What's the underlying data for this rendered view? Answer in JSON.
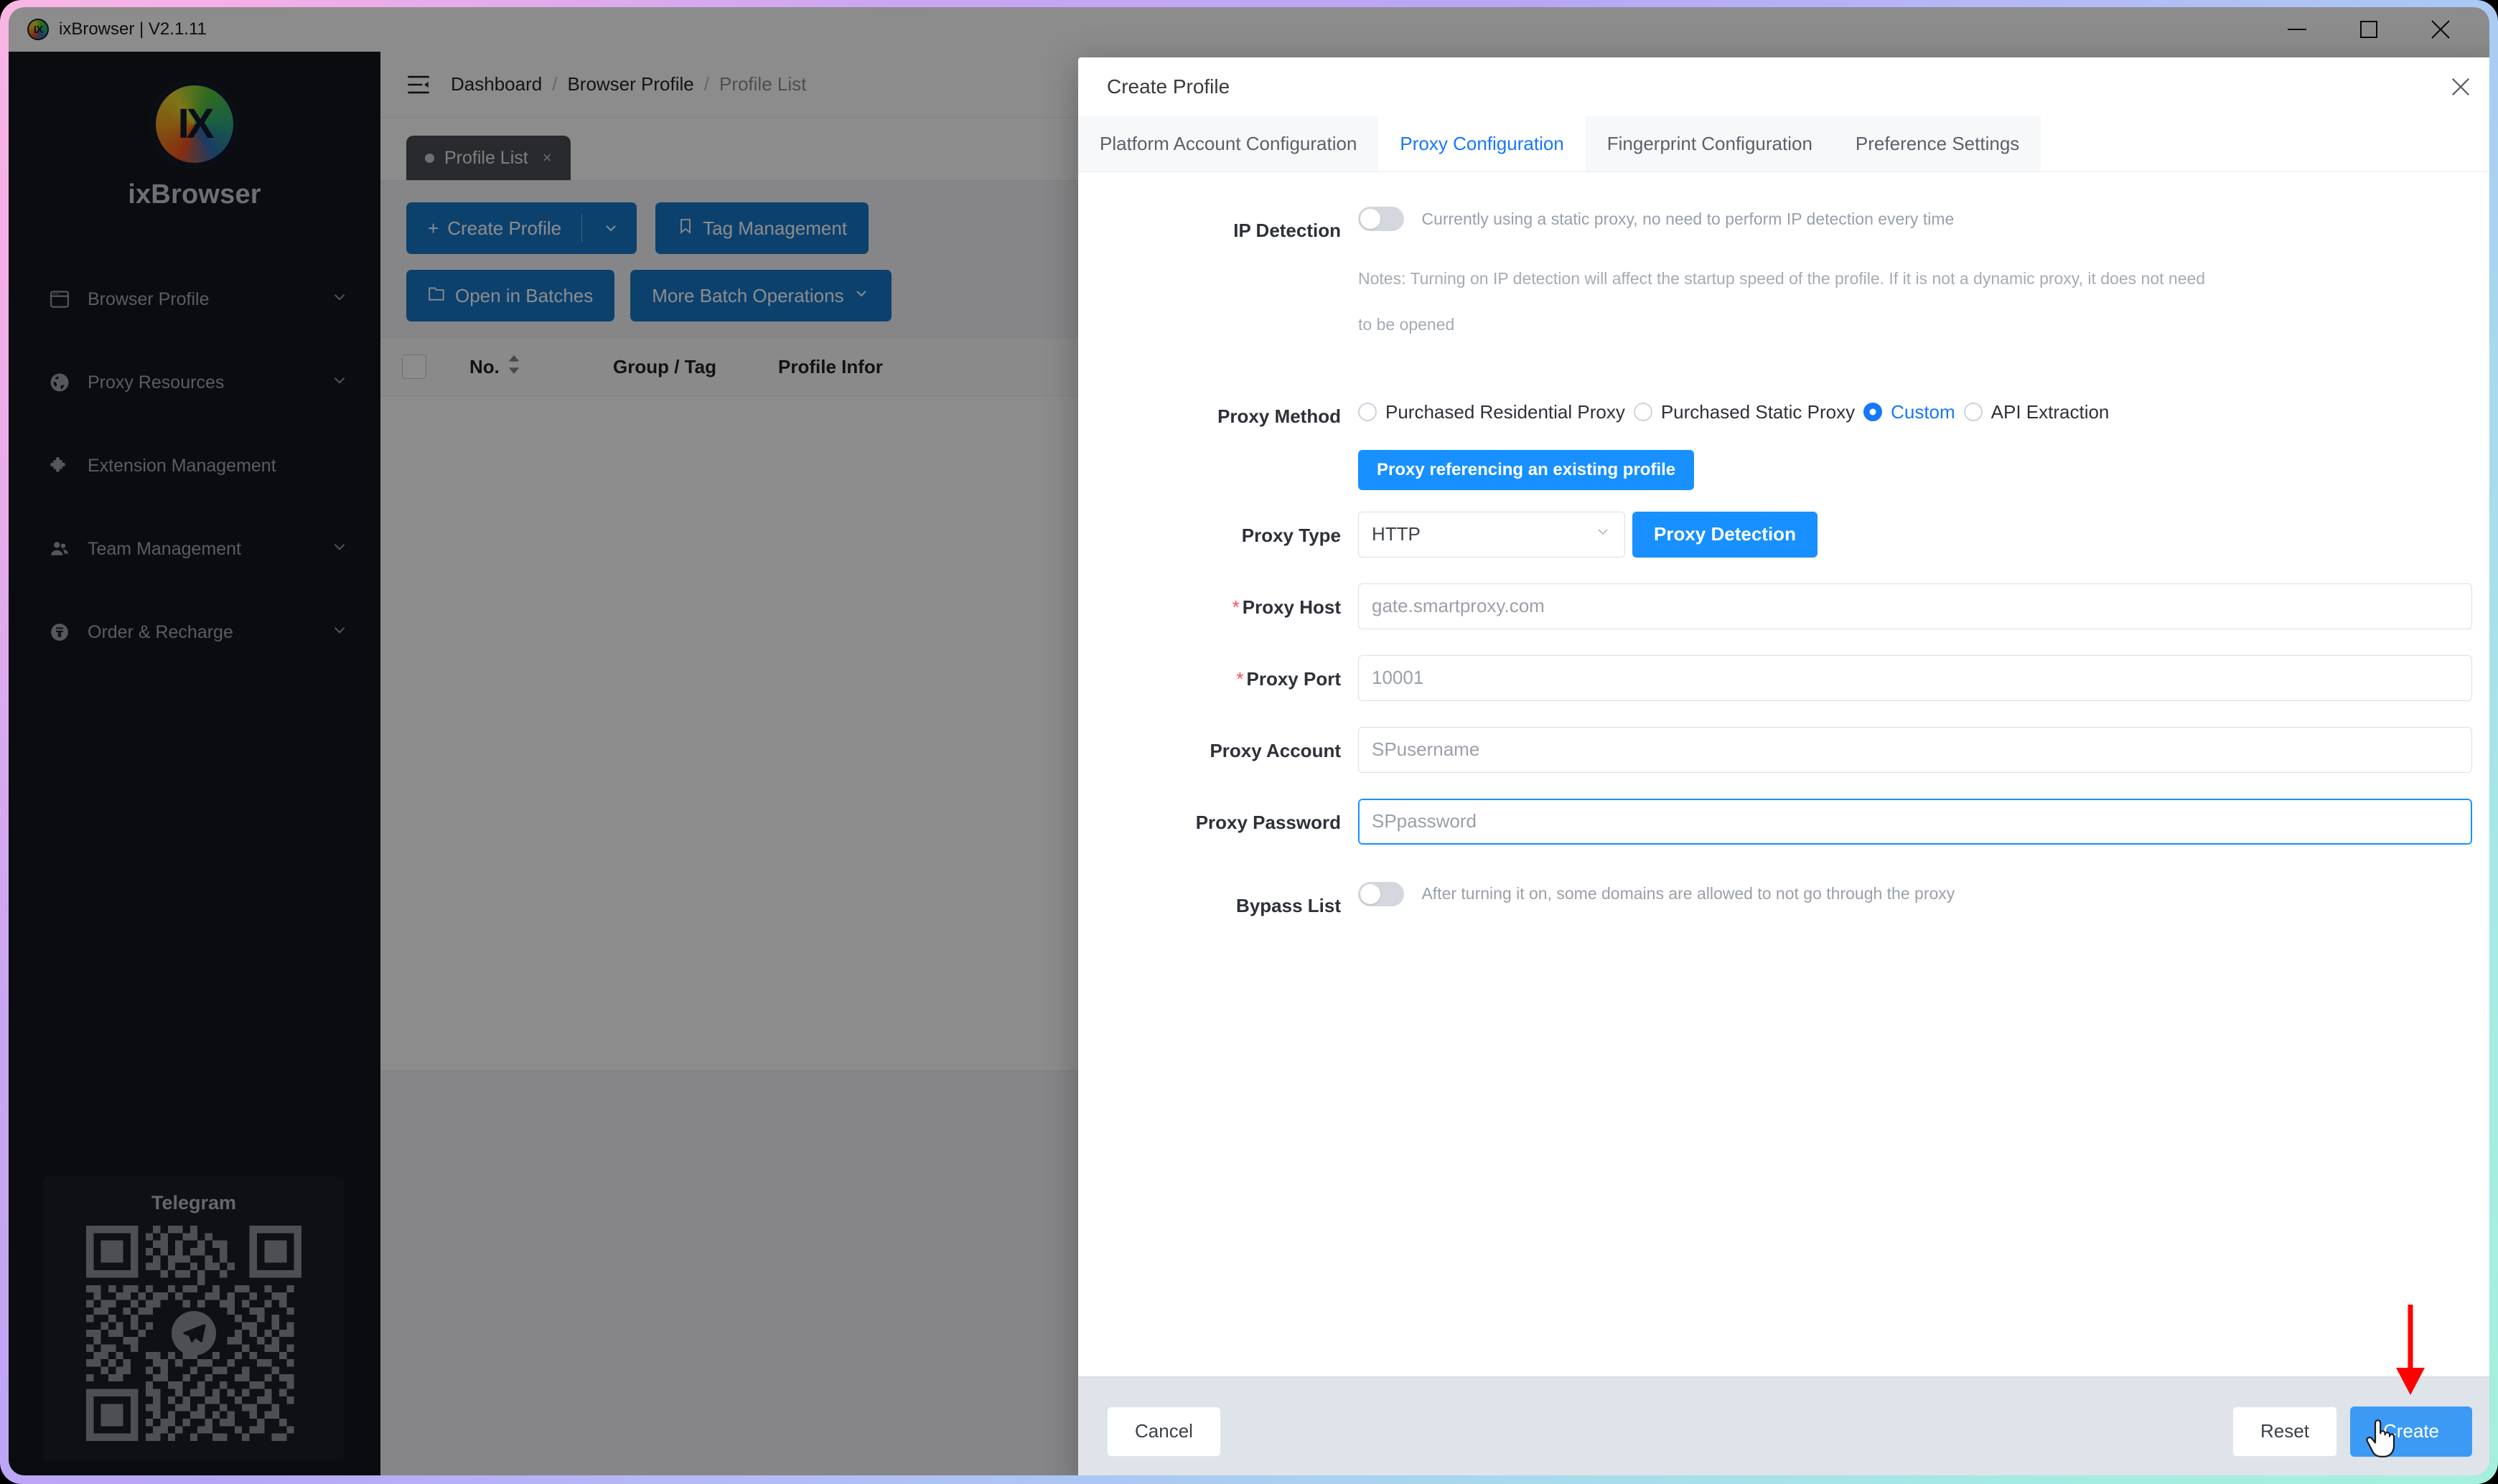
{
  "titlebar": {
    "app_name": "ixBrowser | V2.1.11",
    "logo_text": "IX",
    "minimize": "minimize-icon",
    "maximize": "maximize-icon",
    "close": "close-icon"
  },
  "sidebar": {
    "brand": "ixBrowser",
    "brand_logo_text": "IX",
    "items": [
      {
        "label": "Browser Profile",
        "icon": "window-icon",
        "chevron": true
      },
      {
        "label": "Proxy Resources",
        "icon": "globe-icon",
        "chevron": true
      },
      {
        "label": "Extension Management",
        "icon": "puzzle-icon",
        "chevron": false
      },
      {
        "label": "Team Management",
        "icon": "users-icon",
        "chevron": true
      },
      {
        "label": "Order & Recharge",
        "icon": "coin-icon",
        "chevron": true
      }
    ],
    "telegram": {
      "title": "Telegram",
      "qr_alt": "telegram-qr-code"
    }
  },
  "main": {
    "breadcrumb": [
      "Dashboard",
      "Browser Profile",
      "Profile List"
    ],
    "breadcrumb_sep": "/",
    "tab": {
      "label": "Profile List",
      "close": "×"
    },
    "toolbar": {
      "create_profile": "Create Profile",
      "create_profile_plus": "+",
      "tag_management": "Tag Management",
      "open_in_batches": "Open in Batches",
      "more_batch_operations": "More Batch Operations"
    },
    "table_headers": [
      "No.",
      "Group / Tag",
      "Profile Infor"
    ]
  },
  "modal": {
    "title": "Create Profile",
    "close": "close-icon",
    "tabs": [
      {
        "label": "Platform Account Configuration",
        "active": false
      },
      {
        "label": "Proxy Configuration",
        "active": true
      },
      {
        "label": "Fingerprint Configuration",
        "active": false
      },
      {
        "label": "Preference Settings",
        "active": false
      }
    ],
    "ip_detection": {
      "label": "IP Detection",
      "switch_state": "off",
      "hint": "Currently using a static proxy, no need to perform IP detection every time",
      "note_line1": "Notes: Turning on IP detection will affect the startup speed of the profile. If it is not a dynamic proxy, it does not need",
      "note_line2": "to be opened"
    },
    "proxy_method": {
      "label": "Proxy Method",
      "options": [
        {
          "label": "Purchased Residential Proxy",
          "selected": false
        },
        {
          "label": "Purchased Static Proxy",
          "selected": false
        },
        {
          "label": "Custom",
          "selected": true
        },
        {
          "label": "API Extraction",
          "selected": false
        }
      ]
    },
    "reference_button": "Proxy referencing an existing profile",
    "proxy_type": {
      "label": "Proxy Type",
      "value": "HTTP",
      "detect_button": "Proxy Detection"
    },
    "proxy_host": {
      "label": "Proxy Host",
      "required": true,
      "value": "gate.smartproxy.com"
    },
    "proxy_port": {
      "label": "Proxy Port",
      "required": true,
      "value": "10001"
    },
    "proxy_account": {
      "label": "Proxy Account",
      "required": false,
      "value": "SPusername"
    },
    "proxy_password": {
      "label": "Proxy Password",
      "required": false,
      "value": "SPpassword",
      "focused": true
    },
    "bypass_list": {
      "label": "Bypass List",
      "switch_state": "off",
      "hint": "After turning it on, some domains are allowed to not go through the proxy"
    },
    "footer": {
      "cancel": "Cancel",
      "reset": "Reset",
      "create": "Create"
    }
  },
  "annotation": {
    "arrow": "red-down-arrow",
    "cursor": "hand-pointer-cursor",
    "color": "#ff0000"
  },
  "colors": {
    "accent_blue": "#1677ff",
    "button_blue": "#1890ff",
    "toolbar_blue": "#1677c9",
    "create_blue": "#3c9af5",
    "sidebar_bg": "#13161c",
    "required_red": "#ff4d4f"
  }
}
